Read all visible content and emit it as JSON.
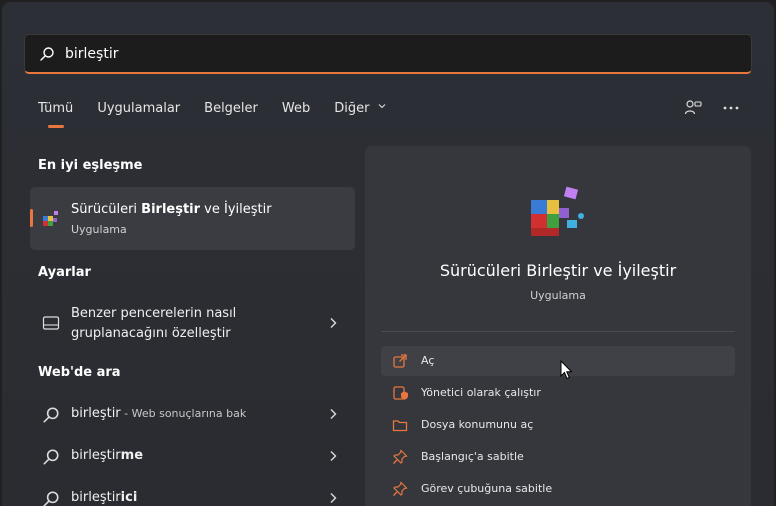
{
  "search": {
    "query": "birleştir"
  },
  "tabs": [
    {
      "label": "Tümü"
    },
    {
      "label": "Uygulamalar"
    },
    {
      "label": "Belgeler"
    },
    {
      "label": "Web"
    },
    {
      "label": "Diğer"
    }
  ],
  "best_match": {
    "section": "En iyi eşleşme",
    "title_pre": "Sürücüleri ",
    "title_bold": "Birleştir",
    "title_post": " ve İyileştir",
    "subtitle": "Uygulama"
  },
  "settings": {
    "section": "Ayarlar",
    "item_line1": "Benzer pencerelerin nasıl",
    "item_line2": "gruplanacağını özelleştir"
  },
  "web": {
    "section": "Web'de ara",
    "items": [
      {
        "bold": "",
        "normal": "birleştir",
        "suffix": " - Web sonuçlarına bak"
      },
      {
        "normal": "birleştir",
        "bold": "me",
        "suffix": ""
      },
      {
        "normal": "birleştir",
        "bold": "ici",
        "suffix": ""
      }
    ]
  },
  "details": {
    "name": "Sürücüleri Birleştir ve İyileştir",
    "type": "Uygulama",
    "actions": [
      {
        "label": "Aç",
        "icon": "open-icon"
      },
      {
        "label": "Yönetici olarak çalıştır",
        "icon": "shield-icon"
      },
      {
        "label": "Dosya konumunu aç",
        "icon": "folder-icon"
      },
      {
        "label": "Başlangıç'a sabitle",
        "icon": "pin-icon"
      },
      {
        "label": "Görev çubuğuna sabitle",
        "icon": "pin-icon"
      }
    ]
  },
  "colors": {
    "accent": "#e8763f",
    "panel": "#2c2f36"
  }
}
